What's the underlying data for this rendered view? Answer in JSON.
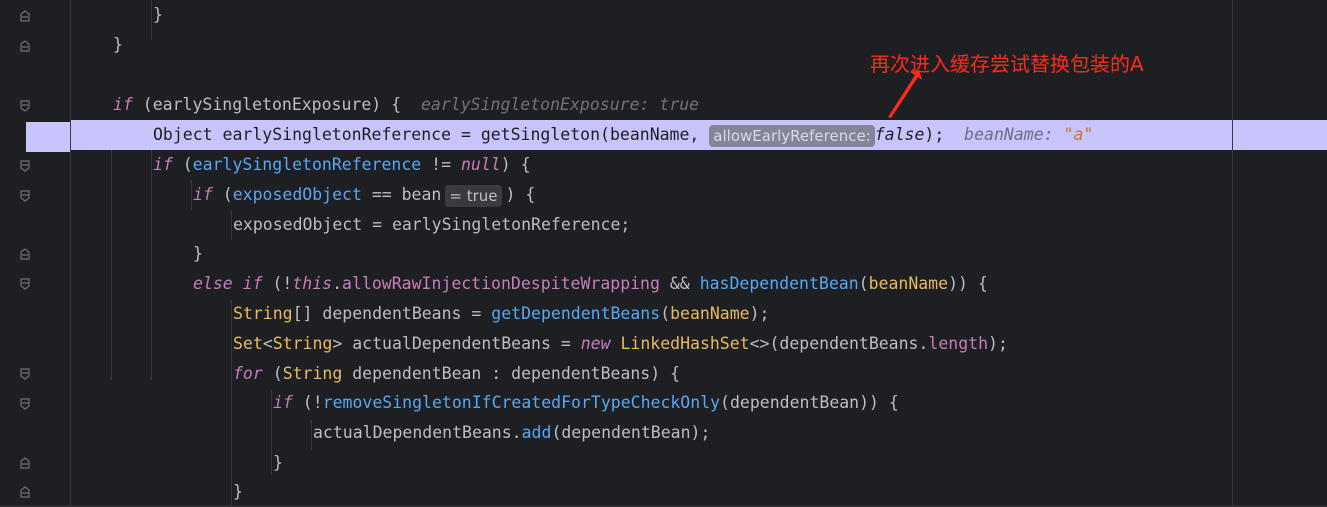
{
  "editor": {
    "lines": [
      {
        "parts": [
          {
            "t": "}",
            "c": ""
          }
        ]
      },
      {
        "parts": [
          {
            "t": "}",
            "c": ""
          }
        ]
      },
      {
        "parts": []
      },
      {
        "parts": [
          {
            "t": "if",
            "c": "kw"
          },
          {
            "t": " (earlySingletonExposure) {  ",
            "c": ""
          },
          {
            "t": "earlySingletonExposure: true",
            "c": "hint"
          }
        ]
      },
      {
        "parts": [
          {
            "t": "Object earlySingletonReference = getSingleton(beanName, ",
            "c": "txt"
          },
          {
            "t": "allowEarlyReference:",
            "c": "chip-light"
          },
          {
            "t": "false",
            "c": "kwi"
          },
          {
            "t": ");  ",
            "c": "txt"
          },
          {
            "t": "beanName: ",
            "c": "hint-dark"
          },
          {
            "t": "\"a\"",
            "c": "hl-str"
          }
        ]
      },
      {
        "parts": [
          {
            "t": "if",
            "c": "kw"
          },
          {
            "t": " (",
            "c": ""
          },
          {
            "t": "earlySingletonReference",
            "c": "mthv"
          },
          {
            "t": " != ",
            "c": ""
          },
          {
            "t": "null",
            "c": "kw"
          },
          {
            "t": ") {",
            "c": ""
          }
        ]
      },
      {
        "parts": [
          {
            "t": "if",
            "c": "kw"
          },
          {
            "t": " (",
            "c": ""
          },
          {
            "t": "exposedObject",
            "c": "mthv"
          },
          {
            "t": " == bean",
            "c": ""
          },
          {
            "t": "= true",
            "c": "chip-true"
          },
          {
            "t": ") {",
            "c": ""
          }
        ]
      },
      {
        "parts": [
          {
            "t": "exposedObject = earlySingletonReference;",
            "c": ""
          }
        ]
      },
      {
        "parts": [
          {
            "t": "}",
            "c": ""
          }
        ]
      },
      {
        "parts": [
          {
            "t": "else if",
            "c": "kw"
          },
          {
            "t": " (!",
            "c": ""
          },
          {
            "t": "this",
            "c": "kw"
          },
          {
            "t": ".",
            "c": ""
          },
          {
            "t": "allowRawInjectionDespiteWrapping",
            "c": "fld"
          },
          {
            "t": " && ",
            "c": ""
          },
          {
            "t": "hasDependentBean",
            "c": "mth"
          },
          {
            "t": "(",
            "c": ""
          },
          {
            "t": "beanName",
            "c": "typ"
          },
          {
            "t": ")) {",
            "c": ""
          }
        ]
      },
      {
        "parts": [
          {
            "t": "String",
            "c": "typ"
          },
          {
            "t": "[] dependentBeans = ",
            "c": ""
          },
          {
            "t": "getDependentBeans",
            "c": "mth"
          },
          {
            "t": "(",
            "c": ""
          },
          {
            "t": "beanName",
            "c": "typ"
          },
          {
            "t": ");",
            "c": ""
          }
        ]
      },
      {
        "parts": [
          {
            "t": "Set",
            "c": "typ"
          },
          {
            "t": "<",
            "c": ""
          },
          {
            "t": "String",
            "c": "typ"
          },
          {
            "t": "> actualDependentBeans = ",
            "c": ""
          },
          {
            "t": "new",
            "c": "kw"
          },
          {
            "t": " ",
            "c": ""
          },
          {
            "t": "LinkedHashSet",
            "c": "typ"
          },
          {
            "t": "<>(dependentBeans.",
            "c": ""
          },
          {
            "t": "length",
            "c": "fld"
          },
          {
            "t": ");",
            "c": ""
          }
        ]
      },
      {
        "parts": [
          {
            "t": "for",
            "c": "kw"
          },
          {
            "t": " (",
            "c": ""
          },
          {
            "t": "String",
            "c": "typ"
          },
          {
            "t": " dependentBean : dependentBeans) {",
            "c": ""
          }
        ]
      },
      {
        "parts": [
          {
            "t": "if",
            "c": "kw"
          },
          {
            "t": " (!",
            "c": ""
          },
          {
            "t": "removeSingletonIfCreatedForTypeCheckOnly",
            "c": "mth"
          },
          {
            "t": "(dependentBean)) {",
            "c": ""
          }
        ]
      },
      {
        "parts": [
          {
            "t": "actualDependentBeans.",
            "c": ""
          },
          {
            "t": "add",
            "c": "mth"
          },
          {
            "t": "(dependentBean);",
            "c": ""
          }
        ]
      },
      {
        "parts": [
          {
            "t": "}",
            "c": ""
          }
        ]
      },
      {
        "parts": [
          {
            "t": "}",
            "c": ""
          }
        ]
      }
    ]
  },
  "annotation": {
    "text": "再次进入缓存尝试替换包装的A",
    "color": "#ff2a1a"
  }
}
